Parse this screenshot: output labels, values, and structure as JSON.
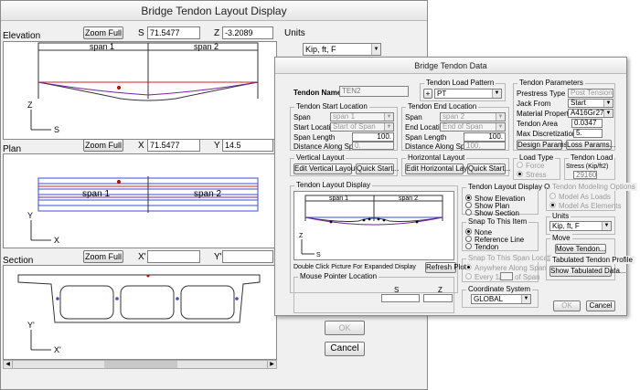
{
  "main_window": {
    "title": "Bridge Tendon Layout Display",
    "elevation": {
      "label": "Elevation",
      "zoom_label": "Zoom Full",
      "s_label": "S",
      "s_value": "71.5477",
      "z_label": "Z",
      "z_value": "-3.2089",
      "span1": "span 1",
      "span2": "span 2",
      "axis_z": "Z",
      "axis_s": "S"
    },
    "plan": {
      "label": "Plan",
      "zoom_label": "Zoom Full",
      "x_label": "X",
      "x_value": "71.5477",
      "y_label": "Y",
      "y_value": "14.5",
      "span1": "span 1",
      "span2": "span 2",
      "axis_y": "Y",
      "axis_x": "X"
    },
    "section": {
      "label": "Section",
      "zoom_label": "Zoom Full",
      "x_label": "X'",
      "y_label": "Y'",
      "axis_y": "Y'",
      "axis_x": "X'"
    },
    "units_group": "Units",
    "units_value": "Kip, ft, F",
    "ok_label": "OK",
    "cancel_label": "Cancel"
  },
  "dialog": {
    "title": "Bridge Tendon Data",
    "tendon_name_label": "Tendon Name",
    "tendon_name_value": "TEN2",
    "load_pattern_group": "Tendon Load Pattern",
    "load_pattern_plus": "+",
    "load_pattern_value": "PT",
    "params_group": "Tendon Parameters",
    "prestress_type_label": "Prestress Type",
    "prestress_type_value": "Post Tension",
    "jack_from_label": "Jack From",
    "jack_from_value": "Start",
    "material_label": "Material Property",
    "material_value": "A416Gr270",
    "area_label": "Tendon Area",
    "area_value": "0.0347",
    "max_disc_label": "Max Discretization Length",
    "max_disc_value": "5.",
    "design_params_label": "Design Params...",
    "loss_params_label": "Loss Params...",
    "start_group": "Tendon Start Location",
    "end_group": "Tendon End Location",
    "span_label": "Span",
    "start_span_value": "span 1",
    "end_span_value": "span 2",
    "start_location_label": "Start Location",
    "start_location_value": "Start of Span",
    "end_location_label": "End Location",
    "end_location_value": "End of Span",
    "span_length_label": "Span Length",
    "start_span_length": "100.",
    "end_span_length": "100.",
    "distance_label": "Distance Along Span",
    "start_distance": "0.",
    "end_distance": "100.",
    "vertical_group": "Vertical Layout",
    "edit_vertical_label": "Edit Vertical Layout...",
    "quick_start_label": "Quick Start...",
    "horizontal_group": "Horizontal Layout",
    "edit_horizontal_label": "Edit Horizontal Layout...",
    "load_type_group": "Load Type",
    "force_label": "Force",
    "stress_label": "Stress",
    "tendon_load_group": "Tendon Load",
    "tendon_load_label": "Stress (Kip/ft2)",
    "tendon_load_value": "29160.",
    "display_group": "Tendon Layout Display",
    "display_span1": "span 1",
    "display_span2": "span 2",
    "axis_z": "Z",
    "axis_s": "S",
    "double_click_note": "Double Click Picture For Expanded Display",
    "refresh_label": "Refresh Plot",
    "mouse_group": "Mouse Pointer Location",
    "mouse_s": "S",
    "mouse_z": "Z",
    "display_options_group": "Tendon Layout Display Options",
    "show_elevation": "Show Elevation",
    "show_plan": "Show Plan",
    "show_section": "Show Section",
    "snap_item_group": "Snap To This Item",
    "snap_none": "None",
    "snap_reference": "Reference Line",
    "snap_tendon": "Tendon",
    "snap_span_group": "Snap To This Span Location",
    "snap_anywhere": "Anywhere Along Span",
    "snap_every": "Every 1/",
    "snap_of_span": "of Span",
    "coord_group": "Coordinate System",
    "coord_value": "GLOBAL",
    "modeling_group": "Tendon Modeling Options",
    "model_loads": "Model As Loads",
    "model_elements": "Model As Elements",
    "units_group": "Units",
    "units_value": "Kip, ft, F",
    "move_group": "Move",
    "move_label": "Move Tendon...",
    "tabulated_group": "Tabulated Tendon Profile",
    "show_tabulated_label": "Show Tabulated Data...",
    "ok_label": "OK",
    "cancel_label": "Cancel"
  },
  "colors": {
    "tendon": "#7a1fa0",
    "reference": "#cc2222",
    "grid": "#3b4fd0",
    "point": "#cc0000"
  }
}
